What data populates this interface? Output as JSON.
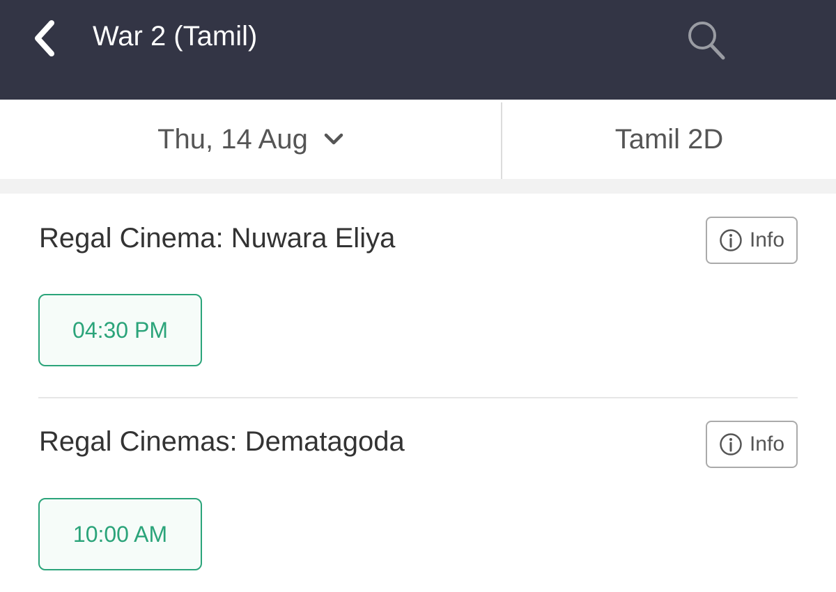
{
  "header": {
    "title": "War 2 (Tamil)",
    "back_icon": "chevron-left-icon",
    "search_icon": "search-icon",
    "background_color": "#333545"
  },
  "filters": {
    "date": "Thu, 14 Aug",
    "date_icon": "chevron-down-icon",
    "format": "Tamil 2D"
  },
  "cinemas": [
    {
      "name": "Regal Cinema: Nuwara Eliya",
      "info_label": "Info",
      "info_icon": "info-circle-icon",
      "showtimes": [
        "04:30 PM"
      ]
    },
    {
      "name": "Regal Cinemas: Dematagoda",
      "info_label": "Info",
      "info_icon": "info-circle-icon",
      "showtimes": [
        "10:00 AM"
      ]
    }
  ],
  "colors": {
    "accent": "#2ba47a",
    "text_primary": "#333333",
    "text_secondary": "#555555"
  }
}
